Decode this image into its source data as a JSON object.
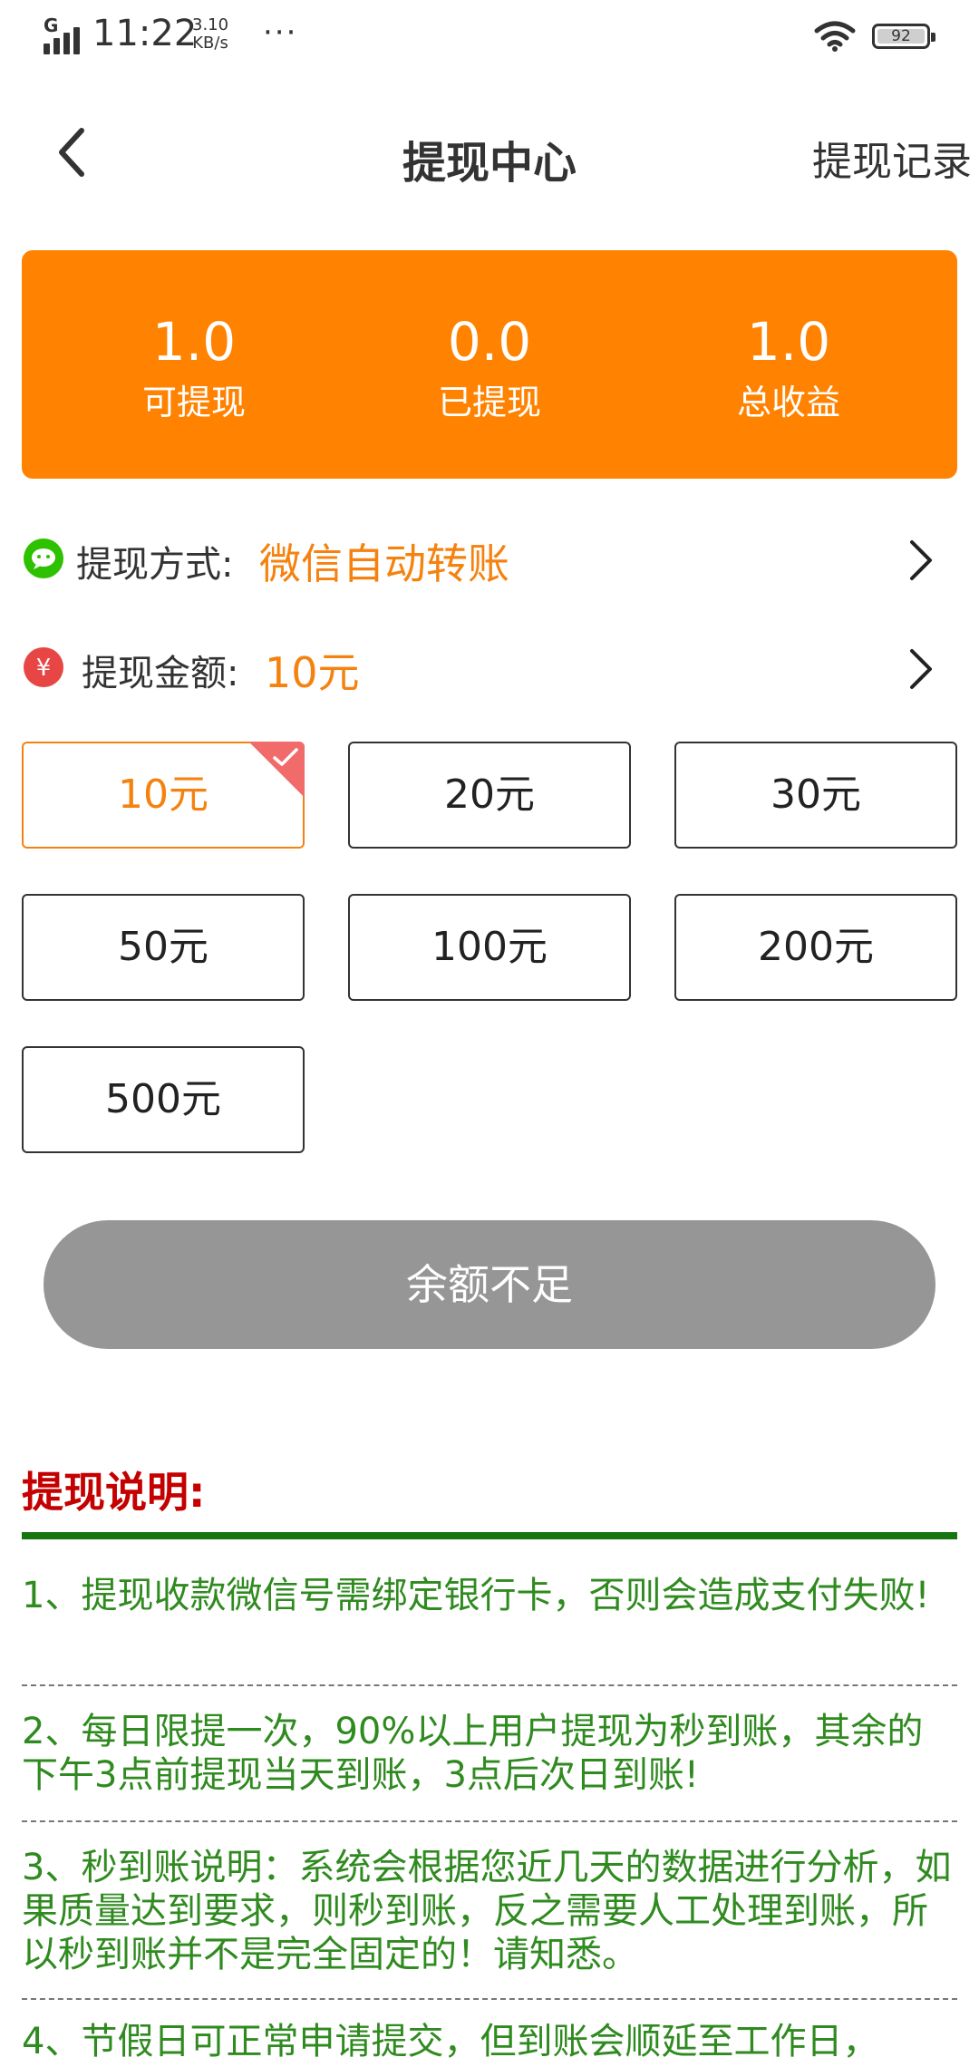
{
  "status_bar": {
    "network": "G",
    "time": "11:22",
    "speed_value": "3.10",
    "speed_unit": "KB/s",
    "more": "···",
    "battery": "92"
  },
  "nav": {
    "title": "提现中心",
    "right_link": "提现记录",
    "back_icon": "chevron-left-icon"
  },
  "stats": [
    {
      "value": "1.0",
      "label": "可提现"
    },
    {
      "value": "0.0",
      "label": "已提现"
    },
    {
      "value": "1.0",
      "label": "总收益"
    }
  ],
  "method": {
    "icon": "wechat-icon",
    "label": "提现方式:",
    "value": "微信自动转账"
  },
  "amount_row": {
    "icon": "yuan-icon",
    "label": "提现金额:",
    "value": "10元"
  },
  "amounts": [
    "10元",
    "20元",
    "30元",
    "50元",
    "100元",
    "200元",
    "500元"
  ],
  "selected_amount": "10元",
  "submit_button": "余额不足",
  "instructions": {
    "title": "提现说明:",
    "items": [
      "1、提现收款微信号需绑定银行卡，否则会造成支付失败!",
      "2、每日限提一次，90%以上用户提现为秒到账，其余的下午3点前提现当天到账，3点后次日到账!",
      "3、秒到账说明：系统会根据您近几天的数据进行分析，如果质量达到要求，则秒到账，反之需要人工处理到账，所以秒到账并不是完全固定的！请知悉。",
      "4、节假日可正常申请提交，但到账会顺延至工作日，"
    ]
  },
  "colors": {
    "accent": "#ff8200",
    "amount_text": "#f5820f",
    "button_disabled": "#969696",
    "instruction_title": "#c40000",
    "instruction_text": "#2f8a1f",
    "rule": "#16750f",
    "wechat_green": "#2dc100",
    "yuan_red": "#e84545"
  }
}
